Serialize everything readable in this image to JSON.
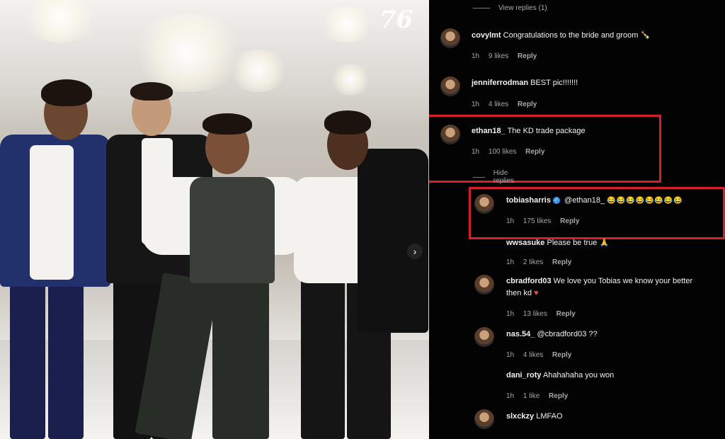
{
  "photo": {
    "watermark": "76",
    "next_icon": "chevron-right-icon"
  },
  "thread": {
    "view_replies_label": "View replies (1)",
    "hide_replies_label": "Hide replies",
    "reply_label": "Reply"
  },
  "comments": [
    {
      "user": "covylmt",
      "text": "Congratulations to the bride and groom 🍾",
      "time": "1h",
      "likes": "9 likes"
    },
    {
      "user": "jenniferrodman",
      "text": "BEST pic!!!!!!!",
      "time": "1h",
      "likes": "4 likes"
    },
    {
      "user": "ethan18_",
      "text": "The KD trade package",
      "time": "1h",
      "likes": "100 likes"
    },
    {
      "user": "tobiasharris",
      "mention": "@ethan18_",
      "text": "😂😂😂😂😂😂😂😂",
      "time": "1h",
      "likes": "175 likes"
    },
    {
      "user": "wwsasuke",
      "text": "Please be true 🙏",
      "time": "1h",
      "likes": "2 likes"
    },
    {
      "user": "cbradford03",
      "text": "We love you Tobias we know your better",
      "text2": "then kd",
      "heart": "♥",
      "time": "1h",
      "likes": "13 likes"
    },
    {
      "user": "nas.54_",
      "mention": "@cbradford03",
      "text": "??",
      "time": "1h",
      "likes": "4 likes"
    },
    {
      "user": "dani_roty",
      "text": "Ahahahaha you won",
      "time": "1h",
      "likes": "1 like"
    },
    {
      "user": "slxckzy",
      "text": "LMFAO"
    }
  ],
  "colors": {
    "highlight": "#d3202a",
    "verified": "#3897f0",
    "heart": "#ed4956"
  }
}
